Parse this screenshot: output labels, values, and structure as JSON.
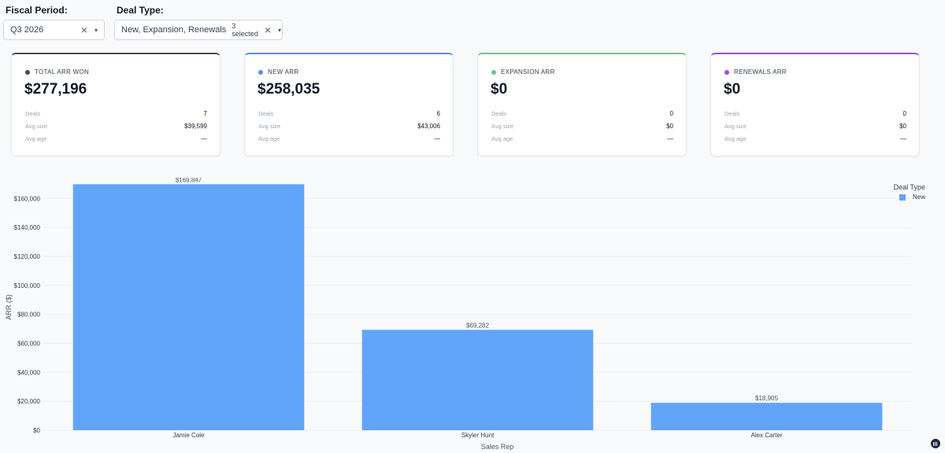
{
  "filters": {
    "period": {
      "label": "Fiscal Period:",
      "value": "Q3 2026"
    },
    "deal_type": {
      "label": "Deal Type:",
      "value": "New, Expansion, Renewals",
      "badge": "3 selected"
    }
  },
  "cards": [
    {
      "title": "TOTAL ARR WON",
      "color": "#4b4b4b",
      "value": "$277,196",
      "stats": [
        {
          "label": "Deals",
          "value": "7"
        },
        {
          "label": "Avg size",
          "value": "$39,599"
        },
        {
          "label": "Avg age",
          "value": "—"
        }
      ]
    },
    {
      "title": "NEW ARR",
      "color": "#5b8def",
      "value": "$258,035",
      "stats": [
        {
          "label": "Deals",
          "value": "6"
        },
        {
          "label": "Avg size",
          "value": "$43,006"
        },
        {
          "label": "Avg age",
          "value": "—"
        }
      ]
    },
    {
      "title": "EXPANSION ARR",
      "color": "#6bc58e",
      "value": "$0",
      "stats": [
        {
          "label": "Deals",
          "value": "0"
        },
        {
          "label": "Avg size",
          "value": "$0"
        },
        {
          "label": "Avg age",
          "value": "—"
        }
      ]
    },
    {
      "title": "RENEWALS ARR",
      "color": "#9b4fe0",
      "value": "$0",
      "stats": [
        {
          "label": "Deals",
          "value": "0"
        },
        {
          "label": "Avg size",
          "value": "$0"
        },
        {
          "label": "Avg age",
          "value": "—"
        }
      ]
    }
  ],
  "chart_data": {
    "type": "bar",
    "categories": [
      "Jamie Cole",
      "Skyler Hunt",
      "Alex Carter"
    ],
    "series": [
      {
        "name": "New",
        "values": [
          169847,
          69282,
          18905
        ],
        "color": "#60a5fa"
      }
    ],
    "data_labels": [
      "$169,847",
      "$69,282",
      "$18,905"
    ],
    "xlabel": "Sales Rep",
    "ylabel": "ARR ($)",
    "ylim": [
      0,
      170000
    ],
    "yticks": [
      0,
      20000,
      40000,
      60000,
      80000,
      100000,
      120000,
      140000,
      160000
    ],
    "ytick_labels": [
      "$0",
      "$20,000",
      "$40,000",
      "$60,000",
      "$80,000",
      "$100,000",
      "$120,000",
      "$140,000",
      "$160,000"
    ],
    "legend_title": "Deal Type",
    "legend_position": "top-right",
    "grid": true
  }
}
